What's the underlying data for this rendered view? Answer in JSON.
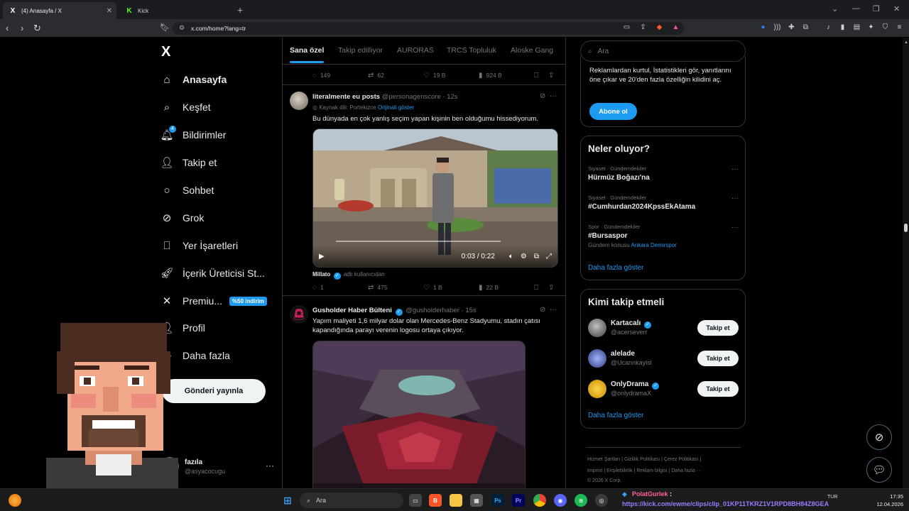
{
  "browser": {
    "tabs": [
      {
        "title": "(4) Anasayfa / X",
        "active": true
      },
      {
        "title": "Kick",
        "active": false
      }
    ],
    "url": "x.com/home?lang=tr"
  },
  "nav": {
    "logo": "X",
    "items": [
      {
        "label": "Anasayfa",
        "icon": "home-icon"
      },
      {
        "label": "Keşfet",
        "icon": "search-icon"
      },
      {
        "label": "Bildirimler",
        "icon": "bell-icon",
        "badge": "4"
      },
      {
        "label": "Takip et",
        "icon": "follow-icon"
      },
      {
        "label": "Sohbet",
        "icon": "chat-icon"
      },
      {
        "label": "Grok",
        "icon": "grok-icon"
      },
      {
        "label": "Yer İşaretleri",
        "icon": "bookmark-icon"
      },
      {
        "label": "İçerik Üreticisi St...",
        "icon": "rocket-icon"
      },
      {
        "label": "Premiu...",
        "icon": "x-icon",
        "promo": "%50 indirim"
      },
      {
        "label": "Profil",
        "icon": "profile-icon"
      },
      {
        "label": "Daha fazla",
        "icon": "more-circle-icon"
      }
    ],
    "post_button": "Gönderi yayınla",
    "account": {
      "name": "fazıla",
      "handle": "@asyacocugu"
    }
  },
  "feed": {
    "tabs": [
      "Sana özel",
      "Takip edilliyor",
      "AURORAS",
      "TRCS Topluluk",
      "Aloske Gang"
    ],
    "top_actions": {
      "replies": "149",
      "reposts": "62",
      "likes": "19 B",
      "views": "924 B"
    },
    "tweets": [
      {
        "name": "literalmente eu posts",
        "handle": "@personagenscore",
        "time": "12s",
        "translate_source": "Kaynak dili: Portekizce",
        "translate_link": "Orijinali göster",
        "text": "Bu dünyada en çok yanlış seçim yapan kişinin ben olduğumu hissediyorum.",
        "video_time": "0:03 / 0:22",
        "source_user": "Millato",
        "source_label": "adlı kullanıcıdan",
        "actions": {
          "replies": "1",
          "reposts": "475",
          "likes": "1 B",
          "views": "22 B"
        }
      },
      {
        "name": "Gusholder Haber Bülteni",
        "handle": "@gusholderhaber",
        "time": "15s",
        "text": "Yapım maliyeti 1,6 milyar dolar olan Mercedes-Benz Stadyumu, stadın çatısı kapandığında parayı verenin  logosu ortaya çıkıyor."
      }
    ]
  },
  "sidebar": {
    "search_placeholder": "Ara",
    "premium_text": "Reklamlardan kurtul, İstatistikleri gör, yanıtlarını öne çıkar ve 20'den fazla özelliğin kilidini aç.",
    "premium_button": "Abone ol",
    "trends_title": "Neler oluyor?",
    "trends": [
      {
        "category": "Siyaset · Gündemdekiler",
        "title": "Hürmüz Boğazı'na",
        "extra": ""
      },
      {
        "category": "Siyaset · Gündemdekiler",
        "title": "#Cumhurdan2024KpssEkAtama",
        "extra": ""
      },
      {
        "category": "Spor · Gündemdekiler",
        "title": "#Bursaspor",
        "extra": "Gündem konusu",
        "extra_link": "Ankara Demirspor"
      }
    ],
    "show_more": "Daha fazla göster",
    "who_title": "Kimi takip etmeli",
    "who": [
      {
        "name": "Kartacalı",
        "handle": "@acerseverr",
        "verified": true
      },
      {
        "name": "alelade",
        "handle": "@Ucannkaylsl",
        "verified": false
      },
      {
        "name": "OnlyDrama",
        "handle": "@onlydramaX",
        "verified": true
      }
    ],
    "follow_label": "Takip et",
    "footer_line1": "Hizmet Şartları  |  Gizlilik Politikası  |  Çerez Politikası  |",
    "footer_line2": "Imprint  |  Erişilebilirlik  |  Reklam bilgisi  |  Daha fazla ···",
    "footer_line3": "© 2026 X Corp."
  },
  "taskbar": {
    "search_placeholder": "Ara",
    "overlay_user": "PolatGurlek",
    "overlay_colon": ":",
    "overlay_link": "https://kick.com/ewme/clips/clip_01KP11TKRZ1V1RPD8BH84Z8GEA",
    "lang": "TUR",
    "time": "17:35",
    "date": "12.04.2026"
  },
  "colors": {
    "accent": "#1d9bf0",
    "background": "#000000",
    "text": "#e7e9ea",
    "muted": "#71767b"
  }
}
